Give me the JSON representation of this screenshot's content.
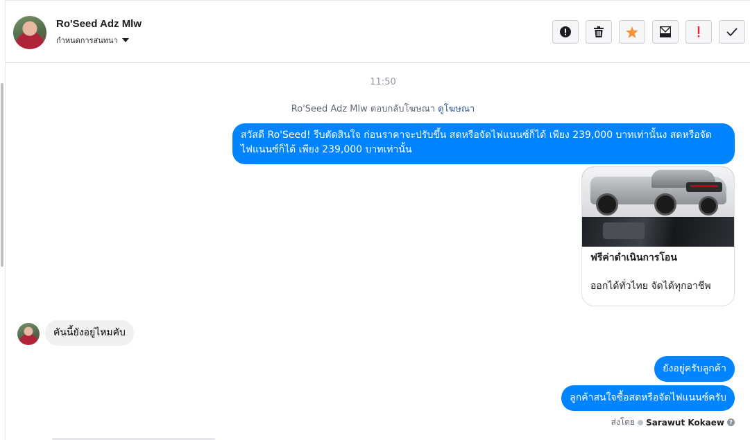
{
  "header": {
    "contact_name": "Ro'Seed Adz Mlw",
    "assign_label": "กำหนดการสนทนา",
    "toolbar": [
      {
        "name": "spam-button",
        "icon": "exclamation-circle-icon"
      },
      {
        "name": "delete-button",
        "icon": "trash-icon"
      },
      {
        "name": "star-button",
        "icon": "star-icon",
        "color": "#f7923b"
      },
      {
        "name": "mark-unread-button",
        "icon": "envelope-icon"
      },
      {
        "name": "important-button",
        "icon": "exclamation-icon",
        "color": "#e41e3f"
      },
      {
        "name": "done-button",
        "icon": "check-icon"
      }
    ]
  },
  "thread": {
    "timestamp": "11:50",
    "ad_reply_text": "Ro'Seed Adz Mlw ตอบกลับโฆษณา",
    "ad_reply_link": "ดูโฆษณา",
    "messages": [
      {
        "direction": "outgoing",
        "text": "สวัสดี Ro'Seed! รีบตัดสินใจ ก่อนราคาจะปรับขึ้น สดหรือจัดไฟแนนซ์ก็ได้ เพียง 239,000 บาทเท่านั้นง สดหรือจัดไฟแนนซ์ก็ได้ เพียง 239,000 บาทเท่านั้น"
      },
      {
        "direction": "incoming",
        "text": "คันนี้ยังอยู่ไหมคับ"
      },
      {
        "direction": "outgoing",
        "text": "ยังอยู่ครับลูกค้า"
      },
      {
        "direction": "outgoing",
        "text": "ลูกค้าสนใจซื้อสดหรือจัดไฟแนนซ์ครับ"
      }
    ],
    "ad_card": {
      "title": "ฟรีค่าดำเนินการโอน",
      "subtitle": "ออกได้ทั่วไทย จัดได้ทุกอาชีพ"
    },
    "sent_by_label": "ส่งโดย",
    "sent_by_agent": "Sarawut Kokaew"
  }
}
